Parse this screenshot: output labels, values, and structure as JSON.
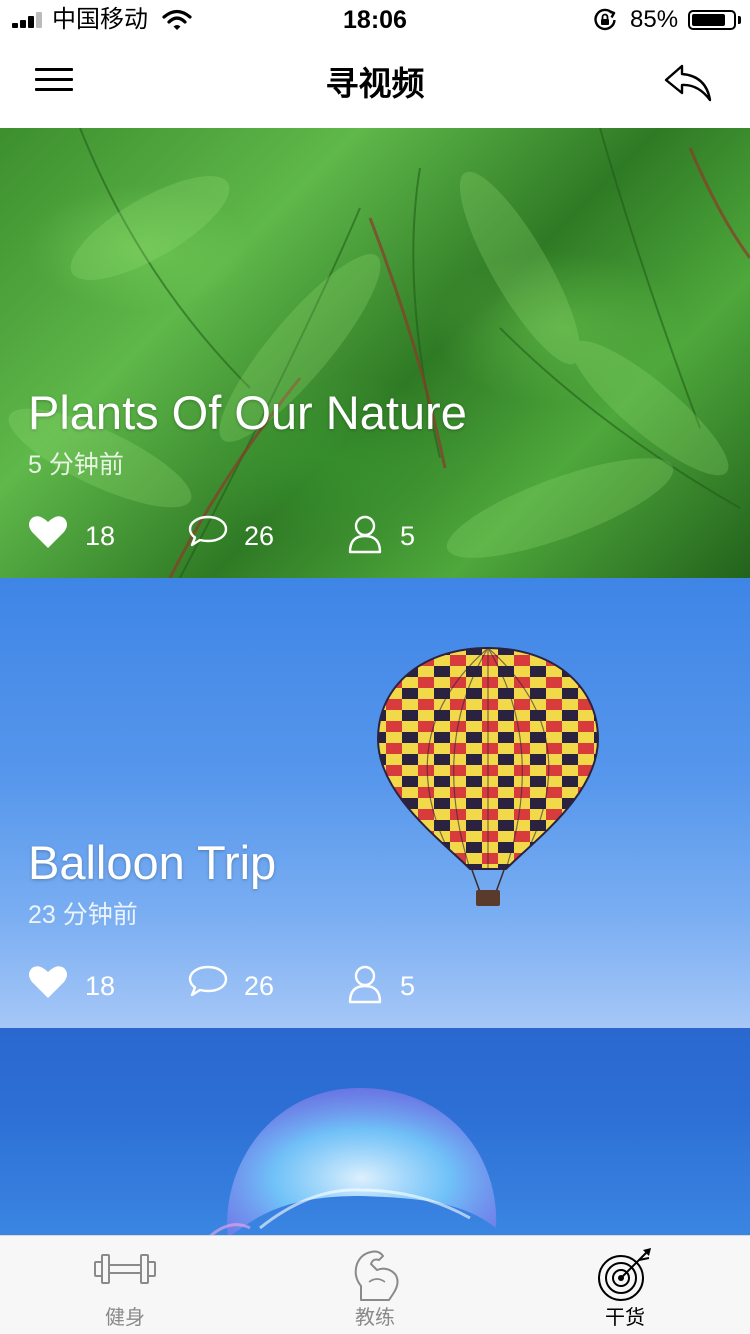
{
  "status_bar": {
    "carrier": "中国移动",
    "time": "18:06",
    "battery_percent": "85%",
    "battery_level": 0.85
  },
  "nav": {
    "title": "寻视频",
    "left_icon": "menu-icon",
    "right_icon": "share-reply-icon"
  },
  "feed": {
    "cards": [
      {
        "title": "Plants Of Our Nature",
        "time": "5 分钟前",
        "likes": "18",
        "comments": "26",
        "users": "5",
        "image": "fern-leaves-photo"
      },
      {
        "title": "Balloon Trip",
        "time": "23 分钟前",
        "likes": "18",
        "comments": "26",
        "users": "5",
        "image": "hot-air-balloon-photo"
      },
      {
        "title": "",
        "time": "",
        "image": "jellyfish-photo"
      }
    ]
  },
  "tab_bar": {
    "items": [
      {
        "label": "健身",
        "icon": "dumbbell-icon",
        "active": false
      },
      {
        "label": "教练",
        "icon": "muscle-arm-icon",
        "active": false
      },
      {
        "label": "干货",
        "icon": "target-dart-icon",
        "active": true
      }
    ]
  },
  "colors": {
    "active_tab": "#000000",
    "inactive_tab": "#8a8a8a",
    "card_text": "#ffffff"
  }
}
